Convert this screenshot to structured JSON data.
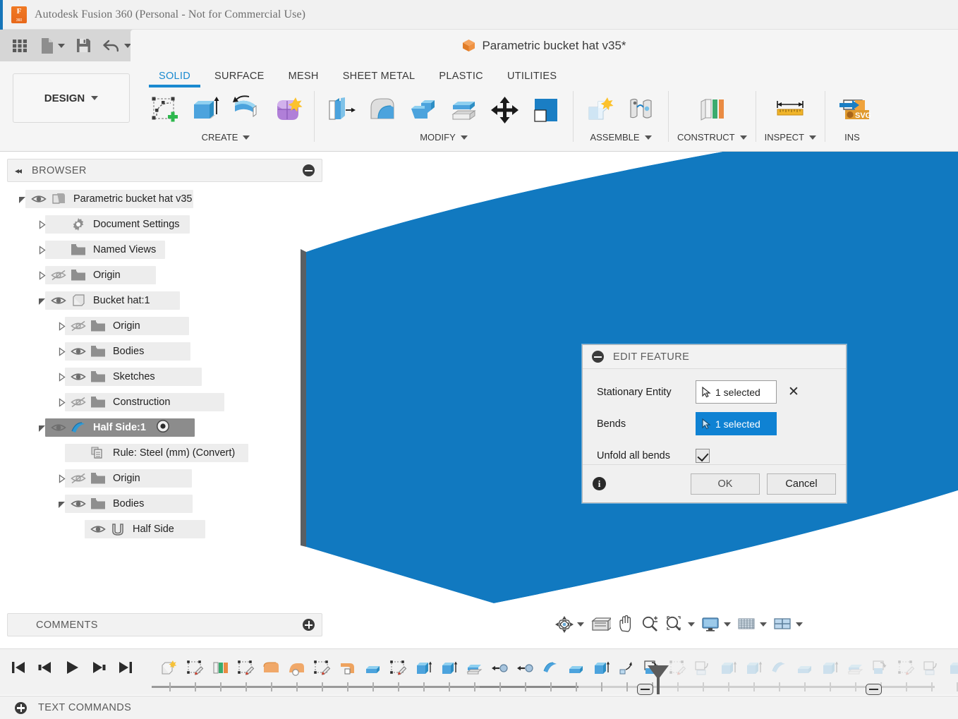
{
  "window": {
    "app_title": "Autodesk Fusion 360 (Personal - Not for Commercial Use)",
    "logo_icon": "fusion-360-logo"
  },
  "quick_access": {
    "items": [
      {
        "name": "app-grid-button",
        "icon": "grid-icon",
        "label": ""
      },
      {
        "name": "new-document-button",
        "icon": "file-icon",
        "label": ""
      },
      {
        "name": "save-button",
        "icon": "floppy-disk-icon",
        "label": ""
      },
      {
        "name": "undo-button",
        "icon": "undo-arrow-icon",
        "label": ""
      },
      {
        "name": "redo-button",
        "icon": "redo-arrow-icon",
        "label": ""
      }
    ]
  },
  "document": {
    "title": "Parametric bucket hat v35*",
    "icon": "orange-cube-icon"
  },
  "ribbon": {
    "workspace_label": "DESIGN",
    "tabs": [
      {
        "label": "SOLID",
        "active": true
      },
      {
        "label": "SURFACE",
        "active": false
      },
      {
        "label": "MESH",
        "active": false
      },
      {
        "label": "SHEET METAL",
        "active": false
      },
      {
        "label": "PLASTIC",
        "active": false
      },
      {
        "label": "UTILITIES",
        "active": false
      }
    ],
    "groups": [
      {
        "label": "CREATE",
        "name": "ribbon-group-create",
        "tools": [
          "create-sketch-icon",
          "extrude-icon",
          "revolve-icon",
          "form-icon"
        ]
      },
      {
        "label": "MODIFY",
        "name": "ribbon-group-modify",
        "tools": [
          "press-pull-icon",
          "fillet-icon",
          "shell-icon",
          "offset-face-icon",
          "move-copy-icon",
          "align-icon"
        ]
      },
      {
        "label": "ASSEMBLE",
        "name": "ribbon-group-assemble",
        "tools": [
          "new-component-icon",
          "joint-icon"
        ]
      },
      {
        "label": "CONSTRUCT",
        "name": "ribbon-group-construct",
        "tools": [
          "offset-plane-icon"
        ]
      },
      {
        "label": "INSPECT",
        "name": "ribbon-group-inspect",
        "tools": [
          "measure-ruler-icon"
        ]
      },
      {
        "label": "INS",
        "name": "ribbon-group-insert",
        "tools": [
          "insert-svg-icon"
        ]
      }
    ]
  },
  "browser": {
    "header_label": "BROWSER",
    "collapse_icon": "collapse-left-icon",
    "toggle_icon": "minus-circle-icon",
    "nodes": [
      {
        "label": "Parametric bucket hat v35",
        "depth": 0,
        "expander": "down",
        "eye": "visible",
        "icon": "document-icon",
        "selected": false,
        "hl_width": 238
      },
      {
        "label": "Document Settings",
        "depth": 1,
        "expander": "right",
        "eye": "none",
        "icon": "gear-icon",
        "selected": false,
        "hl_width": 205
      },
      {
        "label": "Named Views",
        "depth": 1,
        "expander": "right",
        "eye": "none",
        "icon": "folder-icon",
        "selected": false,
        "hl_width": 170
      },
      {
        "label": "Origin",
        "depth": 1,
        "expander": "right",
        "eye": "hidden",
        "icon": "folder-icon",
        "selected": false,
        "hl_width": 157
      },
      {
        "label": "Bucket hat:1",
        "depth": 1,
        "expander": "down",
        "eye": "visible",
        "icon": "component-icon",
        "selected": false,
        "hl_width": 191
      },
      {
        "label": "Origin",
        "depth": 2,
        "expander": "right",
        "eye": "hidden",
        "icon": "folder-icon",
        "selected": false,
        "hl_width": 176
      },
      {
        "label": "Bodies",
        "depth": 2,
        "expander": "right",
        "eye": "visible",
        "icon": "folder-icon",
        "selected": false,
        "hl_width": 178
      },
      {
        "label": "Sketches",
        "depth": 2,
        "expander": "right",
        "eye": "visible",
        "icon": "folder-icon",
        "selected": false,
        "hl_width": 194
      },
      {
        "label": "Construction",
        "depth": 2,
        "expander": "right",
        "eye": "hidden",
        "icon": "folder-icon",
        "selected": false,
        "hl_width": 226
      },
      {
        "label": "Half Side:1",
        "depth": 1,
        "expander": "down",
        "eye": "visible",
        "icon": "sheet-metal-icon",
        "selected": true,
        "hl_width": 212,
        "has_radio": true
      },
      {
        "label": "Rule: Steel (mm) (Convert)",
        "depth": 2,
        "expander": "none",
        "eye": "none",
        "icon": "rule-icon",
        "selected": false,
        "hl_width": 260
      },
      {
        "label": "Origin",
        "depth": 2,
        "expander": "right",
        "eye": "hidden",
        "icon": "folder-icon",
        "selected": false,
        "hl_width": 180
      },
      {
        "label": "Bodies",
        "depth": 2,
        "expander": "down",
        "eye": "visible",
        "icon": "folder-icon",
        "selected": false,
        "hl_width": 181
      },
      {
        "label": "Half Side",
        "depth": 3,
        "expander": "none",
        "eye": "visible",
        "icon": "body-icon",
        "selected": false,
        "hl_width": 171
      }
    ]
  },
  "dialog": {
    "title": "EDIT FEATURE",
    "collapse_icon": "minus-circle-icon",
    "rows": [
      {
        "label": "Stationary Entity",
        "value": "1 selected",
        "type": "selection",
        "active": false,
        "clear_icon": "close-x-icon",
        "cursor_icon": "select-cursor-icon"
      },
      {
        "label": "Bends",
        "value": "1 selected",
        "type": "selection",
        "active": true,
        "cursor_icon": "select-cursor-icon"
      },
      {
        "label": "Unfold all bends",
        "value": "",
        "type": "checkbox",
        "checked": true
      }
    ],
    "info_icon": "info-circle-icon",
    "ok_label": "OK",
    "cancel_label": "Cancel"
  },
  "comments": {
    "label": "COMMENTS",
    "add_icon": "plus-circle-icon"
  },
  "view_toolbar": {
    "items": [
      {
        "name": "orbit-button",
        "icon": "orbit-icon",
        "has_caret": true
      },
      {
        "name": "look-at-button",
        "icon": "look-at-icon",
        "has_caret": false
      },
      {
        "name": "pan-button",
        "icon": "hand-pan-icon",
        "has_caret": false
      },
      {
        "name": "zoom-button",
        "icon": "magnifier-plus-icon",
        "has_caret": false
      },
      {
        "name": "fit-button",
        "icon": "zoom-window-icon",
        "has_caret": true
      },
      {
        "name": "display-settings-button",
        "icon": "monitor-icon",
        "has_caret": true
      },
      {
        "name": "grid-snaps-button",
        "icon": "grid-mesh-icon",
        "has_caret": true
      },
      {
        "name": "viewports-button",
        "icon": "multiple-views-icon",
        "has_caret": true
      }
    ]
  },
  "timeline": {
    "playback": [
      {
        "name": "go-to-beginning-button",
        "icon": "skip-start-icon"
      },
      {
        "name": "step-back-button",
        "icon": "step-back-icon"
      },
      {
        "name": "play-button",
        "icon": "play-icon"
      },
      {
        "name": "step-forward-button",
        "icon": "step-forward-icon"
      },
      {
        "name": "go-to-end-button",
        "icon": "skip-end-icon"
      }
    ],
    "features": [
      {
        "name": "timeline-feature-new-component",
        "icon": "new-component-icon",
        "state": "done"
      },
      {
        "name": "timeline-feature-sketch-1",
        "icon": "sketch-icon",
        "state": "done"
      },
      {
        "name": "timeline-feature-plane",
        "icon": "construction-plane-icon",
        "state": "done"
      },
      {
        "name": "timeline-feature-sketch-2",
        "icon": "sketch-icon",
        "state": "done"
      },
      {
        "name": "timeline-feature-extrude-1",
        "icon": "extrude-orange-icon",
        "state": "done"
      },
      {
        "name": "timeline-feature-loft",
        "icon": "loft-orange-icon",
        "state": "done"
      },
      {
        "name": "timeline-feature-sketch-3",
        "icon": "sketch-icon",
        "state": "done"
      },
      {
        "name": "timeline-feature-revolve",
        "icon": "revolve-orange-icon",
        "state": "done"
      },
      {
        "name": "timeline-feature-shell",
        "icon": "shell-icon",
        "state": "done"
      },
      {
        "name": "timeline-feature-sketch-4",
        "icon": "sketch-icon",
        "state": "done"
      },
      {
        "name": "timeline-feature-extrude-2",
        "icon": "extrude-blue-icon",
        "state": "done"
      },
      {
        "name": "timeline-feature-extrude-3",
        "icon": "extrude-blue-icon",
        "state": "done"
      },
      {
        "name": "timeline-feature-thicken",
        "icon": "thicken-icon",
        "state": "done"
      },
      {
        "name": "timeline-feature-mirror-1",
        "icon": "mirror-icon",
        "state": "done"
      },
      {
        "name": "timeline-feature-mirror-2",
        "icon": "mirror-icon",
        "state": "done"
      },
      {
        "name": "timeline-feature-flange-1",
        "icon": "flange-icon",
        "state": "done"
      },
      {
        "name": "timeline-feature-shell-2",
        "icon": "shell-icon",
        "state": "done"
      },
      {
        "name": "timeline-feature-extrude-4",
        "icon": "extrude-blue-icon",
        "state": "done"
      },
      {
        "name": "timeline-feature-bend",
        "icon": "bend-icon",
        "state": "done"
      },
      {
        "name": "timeline-feature-unfold",
        "icon": "unfold-icon",
        "state": "editing"
      },
      {
        "name": "timeline-feature-sketch-5",
        "icon": "sketch-icon",
        "state": "suppressed"
      },
      {
        "name": "timeline-feature-refold",
        "icon": "refold-icon",
        "state": "suppressed"
      },
      {
        "name": "timeline-feature-extrude-5",
        "icon": "extrude-blue-icon",
        "state": "suppressed"
      },
      {
        "name": "timeline-feature-extrude-6",
        "icon": "extrude-blue-icon",
        "state": "suppressed"
      },
      {
        "name": "timeline-feature-flange-2",
        "icon": "flange-icon",
        "state": "suppressed"
      },
      {
        "name": "timeline-feature-shell-3",
        "icon": "shell-icon",
        "state": "suppressed"
      },
      {
        "name": "timeline-feature-extrude-7",
        "icon": "extrude-blue-icon",
        "state": "suppressed"
      },
      {
        "name": "timeline-feature-thicken-2",
        "icon": "thicken-icon",
        "state": "suppressed"
      },
      {
        "name": "timeline-feature-unfold-2",
        "icon": "unfold-icon",
        "state": "suppressed"
      },
      {
        "name": "timeline-feature-sketch-6",
        "icon": "sketch-icon",
        "state": "suppressed"
      },
      {
        "name": "timeline-feature-refold-2",
        "icon": "refold-icon",
        "state": "suppressed"
      },
      {
        "name": "timeline-feature-extrude-8",
        "icon": "extrude-blue-icon",
        "state": "suppressed"
      }
    ],
    "marker_icon": "timeline-playhead-marker",
    "collapse_left_icon": "minus-pill-icon",
    "collapse_right_icon": "minus-pill-icon"
  },
  "text_commands": {
    "label": "TEXT COMMANDS",
    "expand_icon": "plus-circle-icon"
  },
  "viewport": {
    "model_name": "half-side-sheet-metal-body",
    "body_color": "#1179c0",
    "edge_color": "#5a5f63",
    "background_color": "#ffffff"
  }
}
